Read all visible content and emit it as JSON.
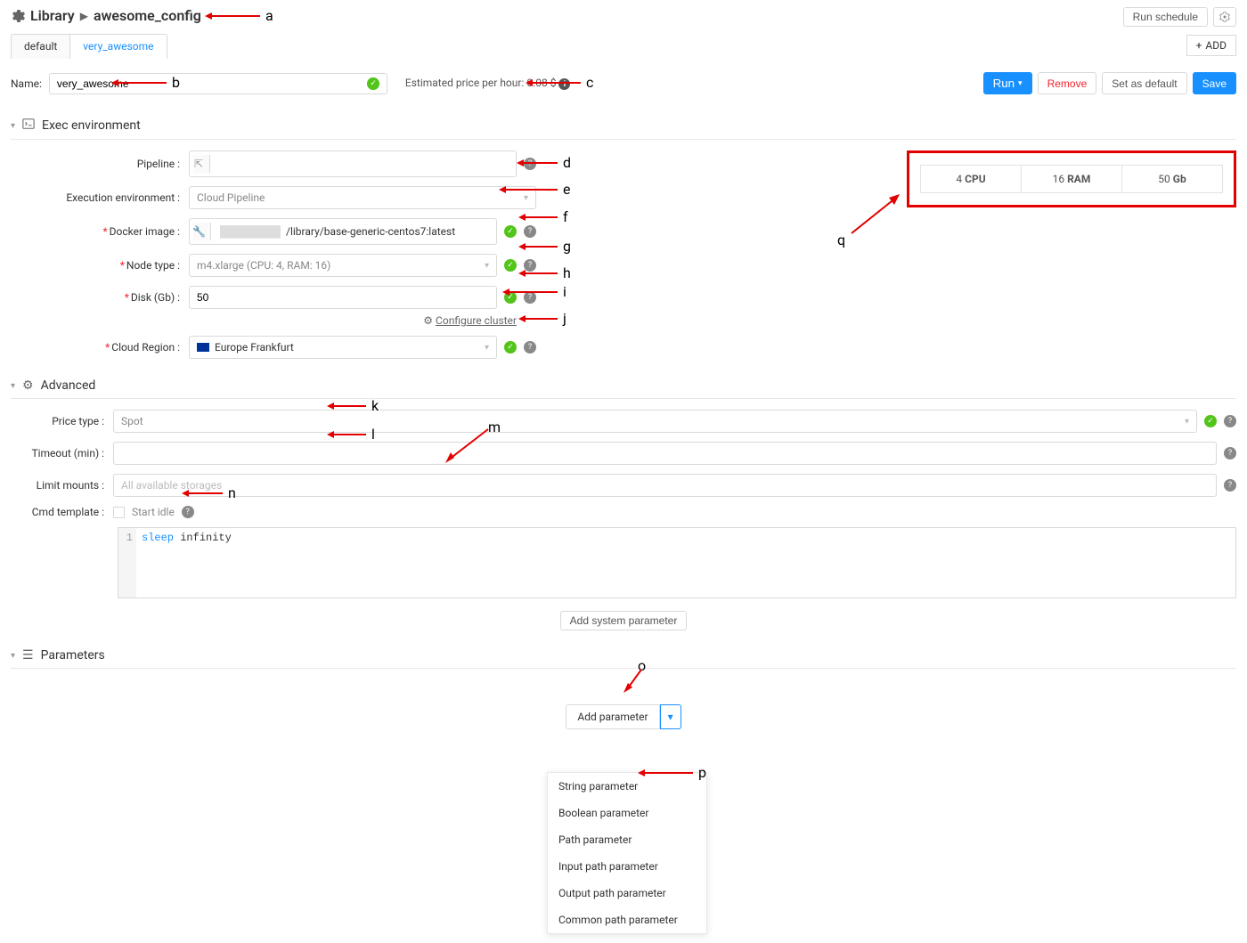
{
  "breadcrumb": {
    "library": "Library",
    "config": "awesome_config"
  },
  "top": {
    "run_schedule": "Run schedule"
  },
  "tabs": {
    "default": "default",
    "active": "very_awesome",
    "add": "ADD"
  },
  "name": {
    "label": "Name:",
    "value": "very_awesome"
  },
  "price": {
    "label": "Estimated price per hour: 0.08 $"
  },
  "actions": {
    "run": "Run",
    "remove": "Remove",
    "default": "Set as default",
    "save": "Save"
  },
  "exec": {
    "title": "Exec environment",
    "pipeline_lbl": "Pipeline :",
    "env_lbl": "Execution environment :",
    "env_val": "Cloud Pipeline",
    "docker_lbl": "Docker image :",
    "docker_val": "/library/base-generic-centos7:latest",
    "node_lbl": "Node type :",
    "node_val": "m4.xlarge (CPU: 4, RAM: 16)",
    "disk_lbl": "Disk (Gb) :",
    "disk_val": "50",
    "cfg_cluster": "Configure cluster",
    "region_lbl": "Cloud Region :",
    "region_val": "Europe Frankfurt"
  },
  "resources": {
    "cpu": "4",
    "cpu_u": "CPU",
    "ram": "16",
    "ram_u": "RAM",
    "disk": "50",
    "disk_u": "Gb"
  },
  "adv": {
    "title": "Advanced",
    "price_lbl": "Price type :",
    "price_val": "Spot",
    "timeout_lbl": "Timeout (min) :",
    "limit_lbl": "Limit mounts :",
    "limit_val": "All available storages",
    "cmd_lbl": "Cmd template :",
    "idle": "Start idle",
    "cmd_kw": "sleep",
    "cmd_rest": " infinity",
    "add_sys": "Add system parameter"
  },
  "params": {
    "title": "Parameters",
    "add": "Add parameter",
    "menu": [
      "String parameter",
      "Boolean parameter",
      "Path parameter",
      "Input path parameter",
      "Output path parameter",
      "Common path parameter"
    ]
  },
  "ann": {
    "a": "a",
    "b": "b",
    "c": "c",
    "d": "d",
    "e": "e",
    "f": "f",
    "g": "g",
    "h": "h",
    "i": "i",
    "j": "j",
    "k": "k",
    "l": "l",
    "m": "m",
    "n": "n",
    "o": "o",
    "p": "p",
    "q": "q"
  }
}
